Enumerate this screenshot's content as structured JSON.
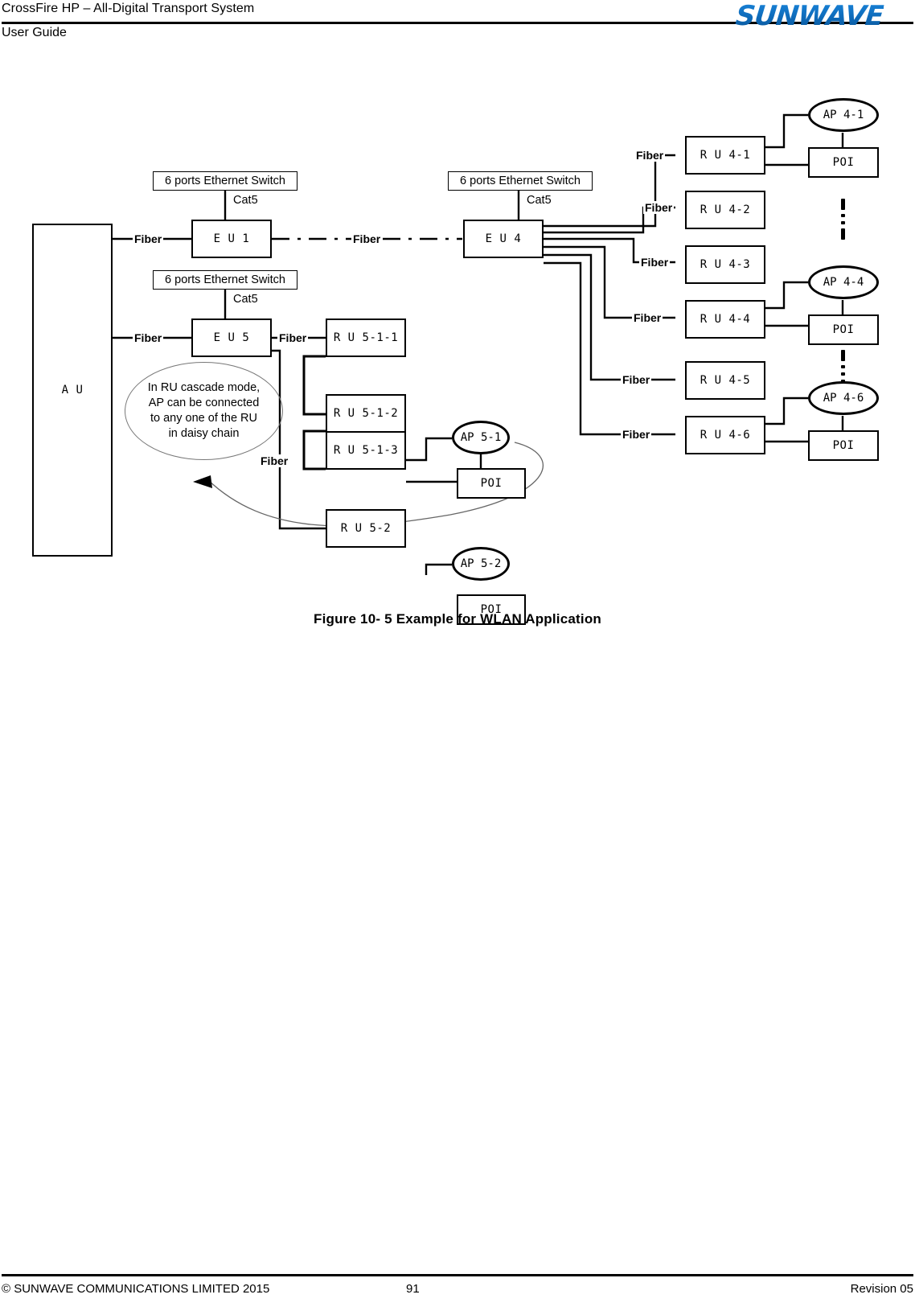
{
  "header": {
    "title_line1": "CrossFire HP – All-Digital Transport System",
    "title_line2": "User Guide",
    "logo": "SUNWAVE"
  },
  "footer": {
    "copyright": "© SUNWAVE COMMUNICATIONS LIMITED 2015",
    "page_number": "91",
    "revision": "Revision 05"
  },
  "figure": {
    "caption": "Figure 10- 5 Example for WLAN Application"
  },
  "diagram": {
    "au": {
      "label": "A U"
    },
    "note": {
      "text": "In RU cascade mode,\nAP can be connected\nto any one of the  RU\nin daisy chain"
    },
    "switches": [
      {
        "id": "sw1",
        "label": "6 ports Ethernet Switch"
      },
      {
        "id": "sw5",
        "label": "6 ports Ethernet Switch"
      },
      {
        "id": "sw4",
        "label": "6 ports Ethernet Switch"
      }
    ],
    "cat5_labels": [
      {
        "id": "cat5-eu1",
        "label": "Cat5"
      },
      {
        "id": "cat5-eu5",
        "label": "Cat5"
      },
      {
        "id": "cat5-eu4",
        "label": "Cat5"
      }
    ],
    "eus": [
      {
        "id": "eu1",
        "label": "E U 1"
      },
      {
        "id": "eu5",
        "label": "E U 5"
      },
      {
        "id": "eu4",
        "label": "E U 4"
      }
    ],
    "rus_cascade": [
      {
        "id": "ru511",
        "label": "R U 5-1-1"
      },
      {
        "id": "ru512",
        "label": "R U 5-1-2"
      },
      {
        "id": "ru513",
        "label": "R U 5-1-3"
      },
      {
        "id": "ru52",
        "label": "R U 5-2"
      }
    ],
    "rus_right": [
      {
        "id": "ru41",
        "label": "R U 4-1"
      },
      {
        "id": "ru42",
        "label": "R U 4-2"
      },
      {
        "id": "ru43",
        "label": "R U 4-3"
      },
      {
        "id": "ru44",
        "label": "R U 4-4"
      },
      {
        "id": "ru45",
        "label": "R U 4-5"
      },
      {
        "id": "ru46",
        "label": "R U 4-6"
      }
    ],
    "aps": [
      {
        "id": "ap51",
        "label": "AP 5-1"
      },
      {
        "id": "ap52",
        "label": "AP 5-2"
      },
      {
        "id": "ap41",
        "label": "AP 4-1"
      },
      {
        "id": "ap44",
        "label": "AP 4-4"
      },
      {
        "id": "ap46",
        "label": "AP 4-6"
      }
    ],
    "pois": [
      {
        "id": "poi51",
        "label": "POI"
      },
      {
        "id": "poi52",
        "label": "POI"
      },
      {
        "id": "poi41",
        "label": "POI"
      },
      {
        "id": "poi44",
        "label": "POI"
      },
      {
        "id": "poi46",
        "label": "POI"
      }
    ],
    "fiber_labels": [
      {
        "id": "fb-au-eu1",
        "label": "Fiber"
      },
      {
        "id": "fb-eu1-eu4",
        "label": "Fiber"
      },
      {
        "id": "fb-au-eu5",
        "label": "Fiber"
      },
      {
        "id": "fb-eu5-ru1",
        "label": "Fiber"
      },
      {
        "id": "fb-eu5-ru2",
        "label": "Fiber"
      },
      {
        "id": "fb-ru41",
        "label": "Fiber"
      },
      {
        "id": "fb-ru42",
        "label": "Fiber"
      },
      {
        "id": "fb-ru43",
        "label": "Fiber"
      },
      {
        "id": "fb-ru44",
        "label": "Fiber"
      },
      {
        "id": "fb-ru45",
        "label": "Fiber"
      },
      {
        "id": "fb-ru46",
        "label": "Fiber"
      }
    ]
  }
}
